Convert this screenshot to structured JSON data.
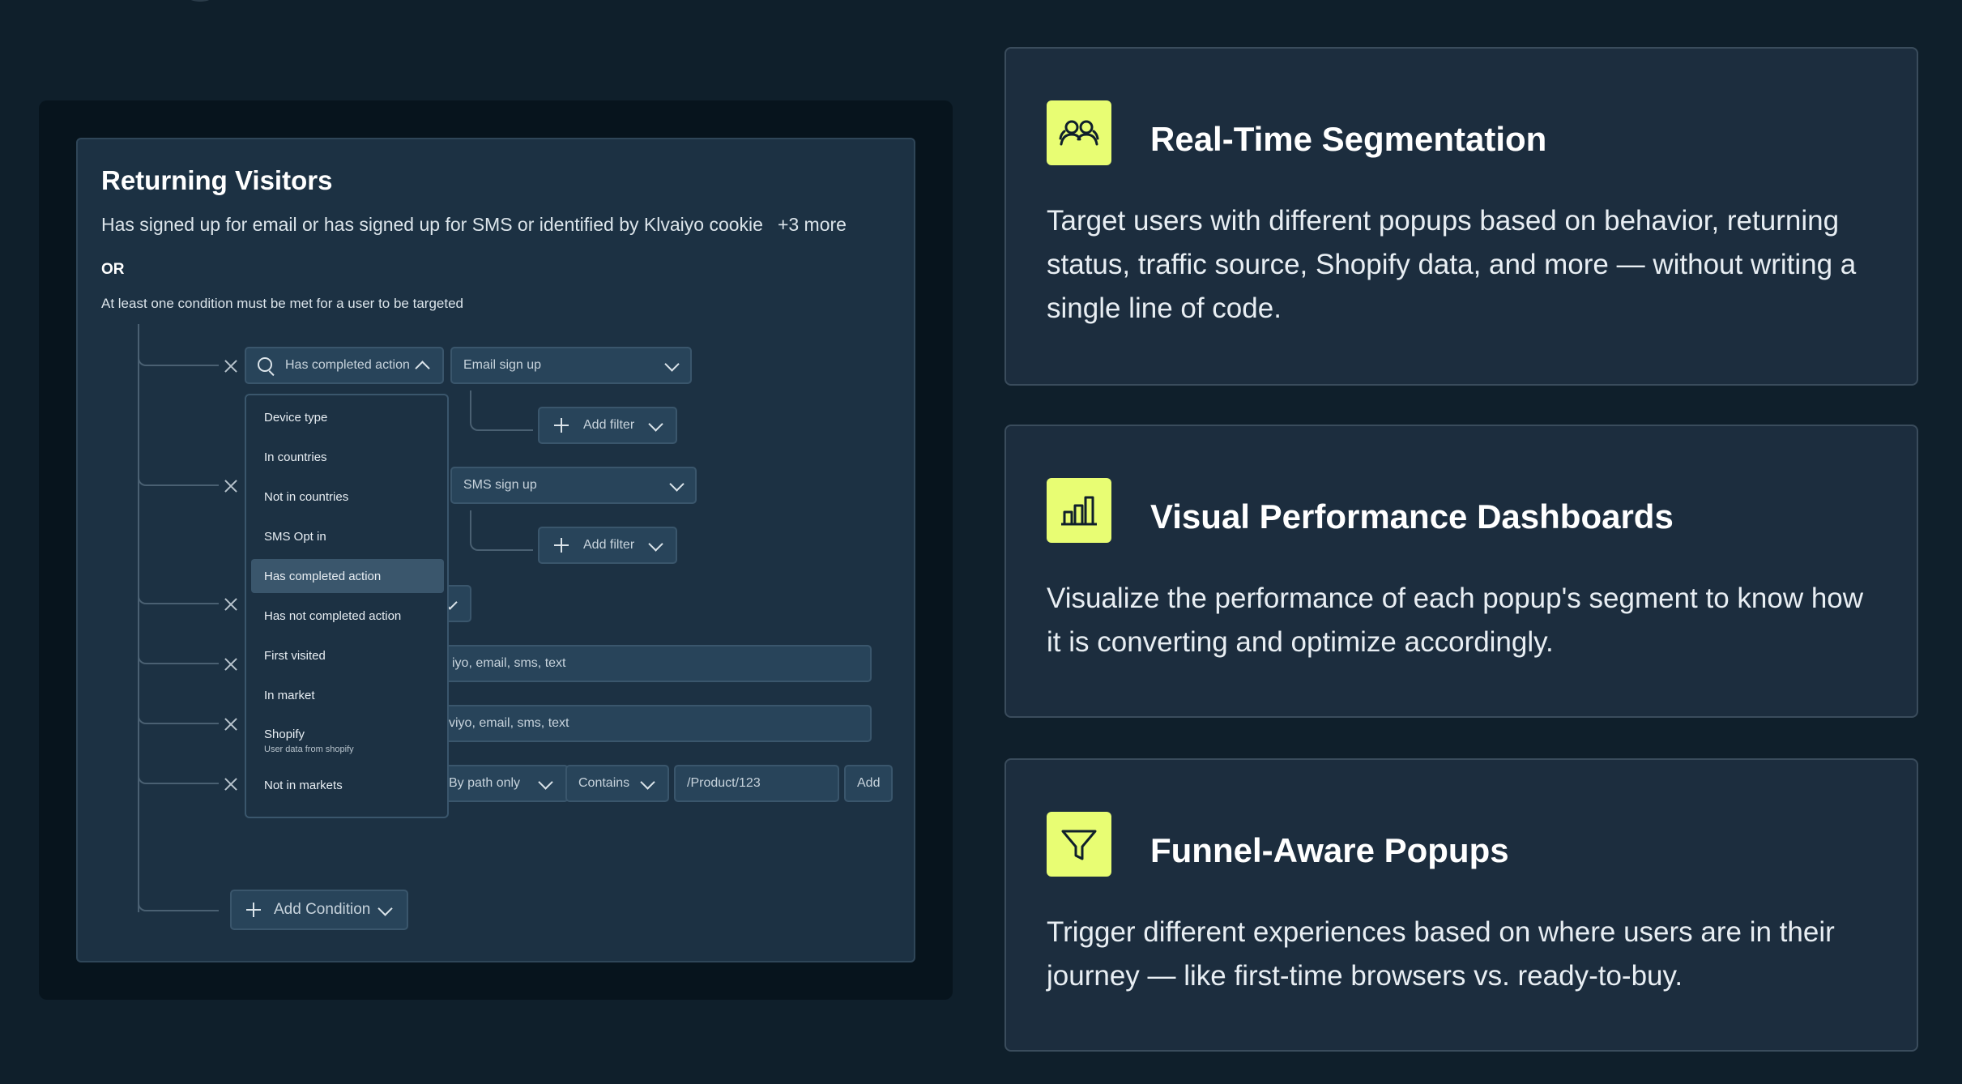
{
  "preview": {
    "title": "Returning Visitors",
    "description": "Has signed up for email or has signed up for SMS or identified by Klvaiyo cookie",
    "more": "+3 more",
    "or_label": "OR",
    "note": "At least one condition must be met for a user to be targeted",
    "rows": {
      "condition_select": "Has completed action",
      "action_select_1": "Email sign up",
      "action_select_2": "SMS sign up",
      "add_filter": "Add filter",
      "text_field_1": "iyo, email, sms, text",
      "text_field_2": "viyo, email, sms, text",
      "path_mode": "By path only",
      "operator": "Contains",
      "path_value": "/Product/123",
      "add_button": "Add"
    },
    "dropdown": {
      "items": [
        {
          "label": "Device type",
          "sub": ""
        },
        {
          "label": "In countries",
          "sub": ""
        },
        {
          "label": "Not in countries",
          "sub": ""
        },
        {
          "label": "SMS Opt in",
          "sub": ""
        },
        {
          "label": "Has completed action",
          "sub": ""
        },
        {
          "label": "Has not completed action",
          "sub": ""
        },
        {
          "label": "First visited",
          "sub": ""
        },
        {
          "label": "In market",
          "sub": ""
        },
        {
          "label": "Shopify",
          "sub": "User data from shopify"
        },
        {
          "label": "Not in markets",
          "sub": ""
        }
      ],
      "selected": "Has completed action"
    },
    "add_condition": "Add Condition"
  },
  "cards": [
    {
      "icon": "people-icon",
      "title": "Real-Time Segmentation",
      "body": "Target users with different popups based on behavior, returning status, traffic source, Shopify data, and more — without writing a single line of code."
    },
    {
      "icon": "bar-chart-icon",
      "title": "Visual Performance Dashboards",
      "body": "Visualize the performance of each popup's segment to know how it is converting and optimize accordingly."
    },
    {
      "icon": "funnel-icon",
      "title": "Funnel-Aware Popups",
      "body": "Trigger different experiences based on where users are in their journey — like first-time browsers vs. ready-to-buy."
    }
  ],
  "colors": {
    "background": "#0f1f2b",
    "card": "#1c2d3e",
    "accent": "#e8fd73",
    "panel": "#1c3143",
    "field": "#28445a"
  }
}
